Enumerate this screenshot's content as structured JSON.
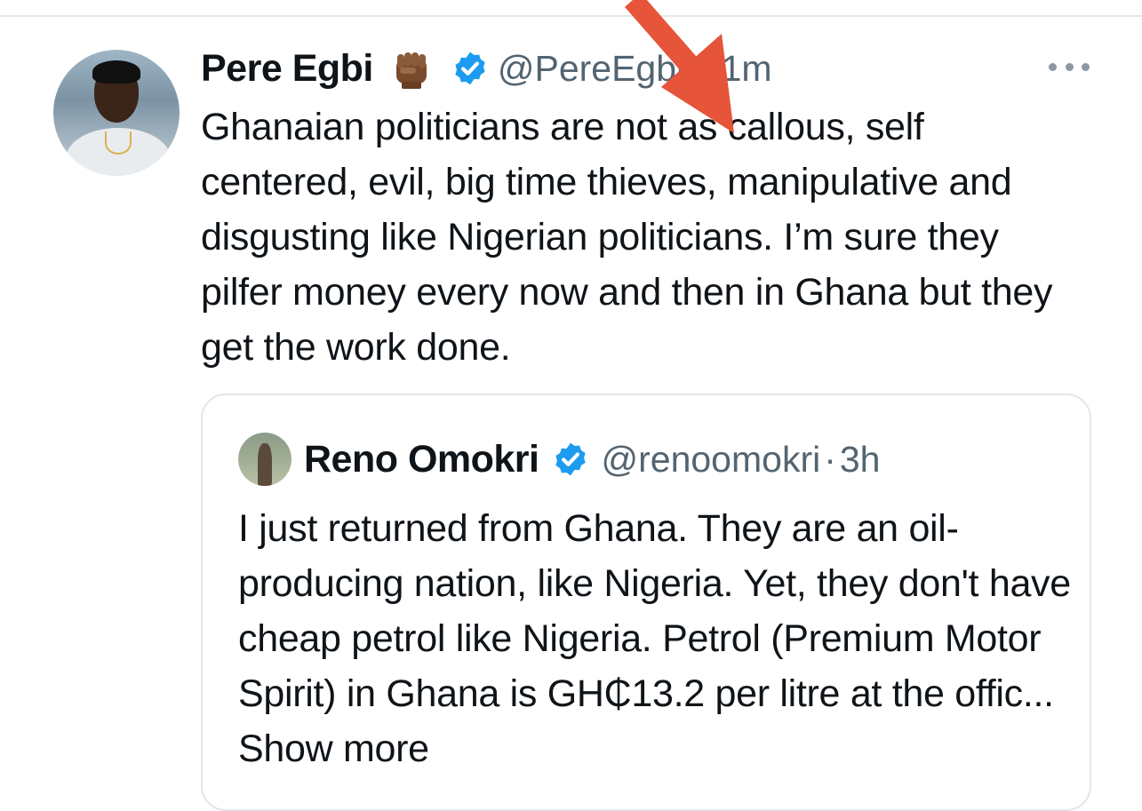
{
  "tweet": {
    "author_name": "Pere Egbi",
    "author_handle": "@PereEgbi",
    "separator": "·",
    "time": "11m",
    "text": "Ghanaian politicians are not as callous, self centered, evil, big time thieves, manipulative and disgusting like Nigerian politicians. I’m sure they pilfer money every now and then in Ghana but they get the work done.",
    "emoji": "raised-fist-dark-skin-tone"
  },
  "quoted_tweet": {
    "author_name": "Reno Omokri",
    "author_handle": "@renoomokri",
    "separator": "·",
    "time": "3h",
    "text": "I just returned from Ghana. They are an oil-producing nation, like Nigeria. Yet, they don't have cheap petrol like Nigeria. Petrol (Premium Motor Spirit) in Ghana is GH₵13.2 per litre at the offic...",
    "show_more_label": "Show more"
  },
  "icons": {
    "verified": "verified-badge-icon",
    "more": "more-options-icon",
    "annotation": "red-arrow"
  },
  "colors": {
    "verified": "#1d9bf0",
    "secondary_text": "#536471",
    "arrow": "#e6543a"
  }
}
